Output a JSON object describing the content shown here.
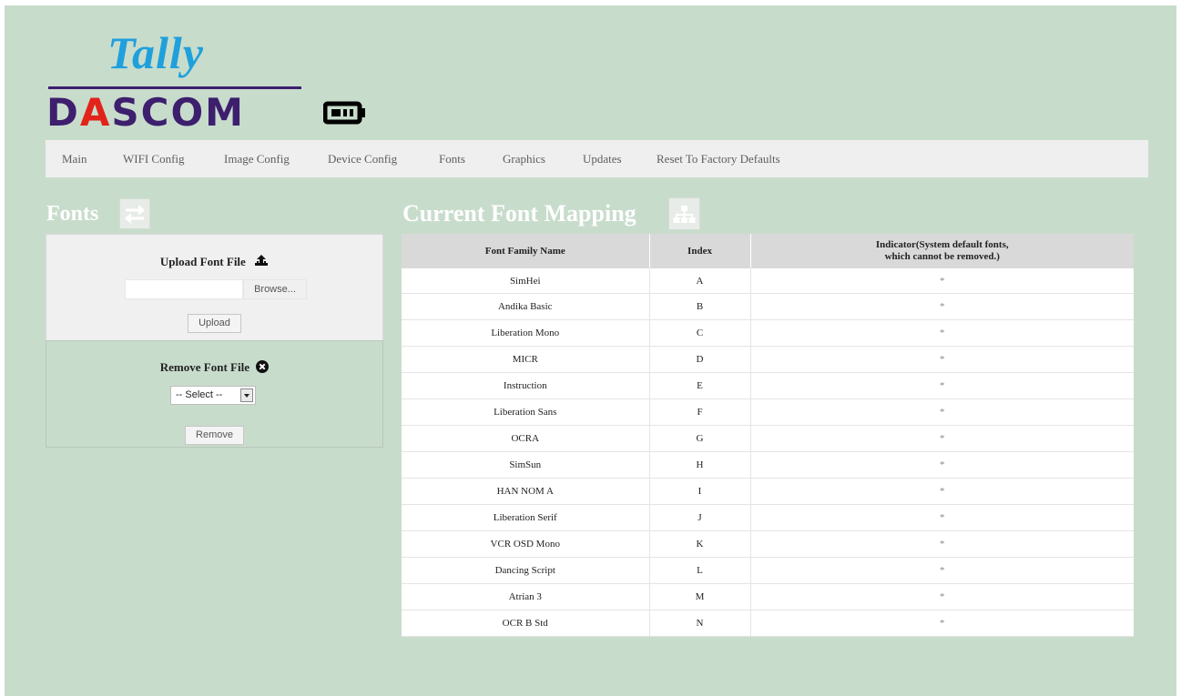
{
  "logo": {
    "tally": "Tally",
    "dascom_parts": [
      "D",
      "A",
      "SCOM"
    ],
    "brand_colors": {
      "tally": "#1fa0dc",
      "dascom": "#3d1f6e",
      "accent": "#e2231a"
    }
  },
  "nav": {
    "items": [
      {
        "label": "Main"
      },
      {
        "label": "WIFI Config"
      },
      {
        "label": "Image Config"
      },
      {
        "label": "Device Config"
      },
      {
        "label": "Fonts"
      },
      {
        "label": "Graphics"
      },
      {
        "label": "Updates"
      },
      {
        "label": "Reset To Factory Defaults"
      }
    ]
  },
  "fonts_section": {
    "title": "Fonts",
    "icon": "swap-arrows-icon",
    "upload": {
      "title": "Upload Font File",
      "icon": "upload-icon",
      "file_value": "",
      "browse_label": "Browse...",
      "upload_label": "Upload"
    },
    "remove": {
      "title": "Remove Font File",
      "icon": "remove-circle-icon",
      "select_value": "-- Select --",
      "remove_label": "Remove"
    }
  },
  "mapping_section": {
    "title": "Current Font Mapping",
    "icon": "sitemap-icon",
    "columns": {
      "family": "Font Family Name",
      "index": "Index",
      "indicator_line1": "Indicator(System default fonts,",
      "indicator_line2": "which cannot be removed.)"
    },
    "rows": [
      {
        "family": "SimHei",
        "index": "A",
        "indicator": "*"
      },
      {
        "family": "Andika Basic",
        "index": "B",
        "indicator": "*"
      },
      {
        "family": "Liberation Mono",
        "index": "C",
        "indicator": "*"
      },
      {
        "family": "MICR",
        "index": "D",
        "indicator": "*"
      },
      {
        "family": "Instruction",
        "index": "E",
        "indicator": "*"
      },
      {
        "family": "Liberation Sans",
        "index": "F",
        "indicator": "*"
      },
      {
        "family": "OCRA",
        "index": "G",
        "indicator": "*"
      },
      {
        "family": "SimSun",
        "index": "H",
        "indicator": "*"
      },
      {
        "family": "HAN NOM A",
        "index": "I",
        "indicator": "*"
      },
      {
        "family": "Liberation Serif",
        "index": "J",
        "indicator": "*"
      },
      {
        "family": "VCR OSD Mono",
        "index": "K",
        "indicator": "*"
      },
      {
        "family": "Dancing Script",
        "index": "L",
        "indicator": "*"
      },
      {
        "family": "Atrian 3",
        "index": "M",
        "indicator": "*"
      },
      {
        "family": "OCR B Std",
        "index": "N",
        "indicator": "*"
      }
    ]
  }
}
